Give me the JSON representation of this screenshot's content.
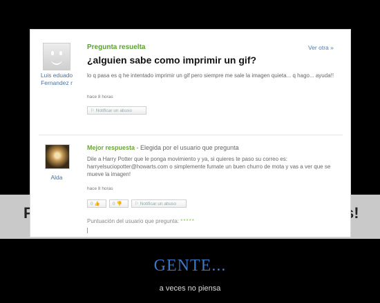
{
  "band": {
    "left_letter": "P",
    "right_letter": "s!"
  },
  "question": {
    "status": "Pregunta resuelta",
    "ver_otra": "Ver otra »",
    "avatar_icon": "smiley-avatar-icon",
    "user_name_line1": "Luis eduado",
    "user_name_line2": "Fernandez r",
    "title": "¿alguien sabe como imprimir un gif?",
    "body": "lo q pasa es q he intentado imprimir un gif pero siempre me sale la imagen quieta... q hago... ayuda!!",
    "time": "hace 8 horas",
    "report_label": "Notificar un abuso"
  },
  "answer": {
    "best_label": "Mejor respuesta",
    "chosen_by": " - Elegida por el usuario que pregunta",
    "user_name": "Alda",
    "body": "Dile a Harry Potter que le ponga movimiento y ya, si quieres te paso su correo es: harryelsuciopotter@howarts.com o simplemente fumate un buen churro de mota y vas a ver que se mueve la imagen!",
    "time": "hace 8 horas",
    "thumbs_up_count": "0",
    "thumbs_down_count": "0",
    "report_label": "Notificar un abuso",
    "rating_label": "Puntuación del usuario que pregunta:",
    "rating_stars": "*****"
  },
  "poster": {
    "headline": "GENTE...",
    "subline": "a veces no piensa"
  },
  "colors": {
    "accent_green": "#59a12e",
    "link_blue": "#4a7ab0",
    "headline_blue": "#3d78c2"
  }
}
